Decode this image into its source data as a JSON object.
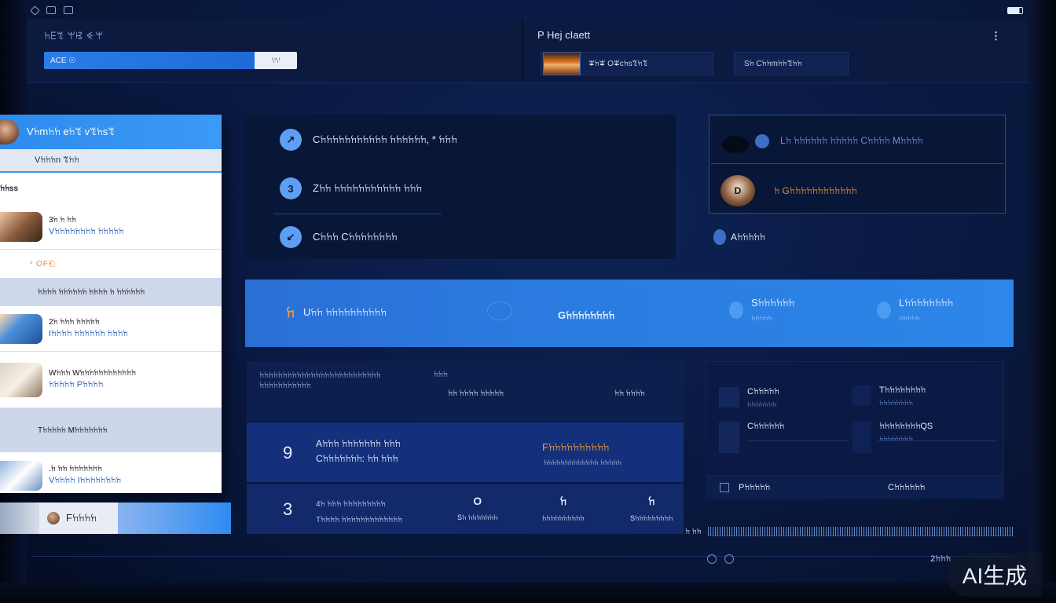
{
  "header": {
    "brand": "ꖷꗋꔳ ꕚꕙ ꔾꕚ",
    "search_value": "ACE ☉",
    "search_button": "ꗷꗷ",
    "doc_title": "P Hej cIaett",
    "more": "⋮",
    "file_chip_label": "ꕾꖷꕾ Oꕾcꖷsꔳꖷꔳ",
    "status_chip_label": "Sꖷ Cꖷꖷmꖷꖷꔳꖷꖷ"
  },
  "sidebar": {
    "title": "Vꖷmꖷꖷ eꖷꔳ vꔳꖷsꔳ",
    "view_label": "Vꖷꖷꖷn ꔳꖷꖷ",
    "section_label": "ꖷꖷss",
    "items": [
      {
        "title": "3ꖷ ꖷ ꖷꖷ",
        "subtitle": "Vꖷꖷꖷꖷꖷꖷꖷꖷ ꖷꖷꖷꖷꖷ"
      },
      {
        "title": "2ꖷ ꖷꖷꖷ ꖷꖷꖷꖷꖷ",
        "subtitle": "Iꖷꖷꖷꖷ ꖷꖷꖷꖷꖷꖷ ꖷꖷꖷꖷ"
      },
      {
        "title": "Wꖷꖷꖷ Wꖷꖷꖷꖷꖷꖷꖷꖷꖷꖷꖷꖷ",
        "subtitle": "ꖷꖷꖷꖷꖷ Pꖷꖷꖷꖷ"
      },
      {
        "title": ".ꖷ ꖷꖷ ꖷꖷꖷꖷꖷꖷꖷ",
        "subtitle": "Vꖷꖷꖷꖷ Iꖷꖷꖷꖷꖷꖷꖷꖷ"
      }
    ],
    "plain_row": "ᵛ OF⎗",
    "group_row_1": "ꖷꖷꖷꖷ ꖷꖷꖷꖷꖷꖷ ꖷꖷꖷꖷ ꖷ ꖷꖷꖷꖷꖷꖷ",
    "group_row_2": "Tꖷꖷꖷꖷꖷ Mꖷꖷꖷꖷꖷꖷꖷ",
    "footer_profile": "Fꖷꖷꖷꖷ"
  },
  "actions": [
    {
      "glyph": "↗",
      "label": "Cꖷꖷꖷꖷꖷꖷꖷꖷꖷꖷꖷ ꖷꖷꖷꖷꖷꖷ, * ꖷꖷꖷ"
    },
    {
      "glyph": "3",
      "label": "Zꖷꖷ ꖷꖷꖷꖷꖷꖷꖷꖷꖷꖷꖷ ꖷꖷꖷ"
    },
    {
      "glyph": "↙",
      "label": "Cꖷꖷꖷ Cꖷꖷꖷꖷꖷꖷꖷꖷ"
    }
  ],
  "notifications": {
    "row1": "Lꖷ ꖷꖷꖷꖷꖷꖷ ꖷꖷꖷꖷꖷ Cꖷꖷꖷꖷ Mꖷꖷꖷꖷ",
    "row2_badge": "D",
    "row2": "ꖷ Gꖷꖷꖷꖷꖷꖷꖷꖷꖷꖷꖷꖷ",
    "tag": "Aꖷꖷꖷꖷꖷ"
  },
  "toolbar": {
    "left_icon": "ꖷ",
    "left_label": "Uꖷꖷ ꖷꖷꖷꖷꖷꖷꖷꖷꖷꖷ",
    "center_label": "Gꖷꖷꖷꖷꖷꖷꖷꖷ",
    "right1_label": "Sꖷꖷꖷꖷꖷꖷ",
    "right1_sub": "ꖷꖷꖷꖷꖷ",
    "right2_label": "Lꖷꖷꖷꖷꖷꖷꖷꖷ",
    "right2_sub": "ꖷꖷꖷꖷꖷ"
  },
  "table": {
    "header_text": "ꖷꖷꖷꖷꖷꖷꖷꖷꖷꖷꖷꖷꖷꖷꖷꖷꖷꖷꖷꖷꖷꖷꖷꖷꖷꖷ ꖷꖷꖷꖷꖷꖷꖷꖷꖷꖷꖷ",
    "header_mid": "ꖷꖷꖷ",
    "header_val1": "ꖷꖷ ꖷꖷꖷꖷ ꖷꖷꖷꖷꖷ",
    "header_val2": "ꖷꖷ ꖷꖷꖷꖷ",
    "row2": {
      "number": "9",
      "line1": "Aꖷꖷꖷ ꖷꖷꖷꖷꖷꖷꖷ ꖷꖷꖷ",
      "line2": "Cꖷꖷꖷꖷꖷꖷꖷ: ꖷꖷ ꖷꖷꖷ",
      "accent": "Fꖷꖷꖷꖷꖷꖷꖷꖷꖷꖷ",
      "accent_sub": "ꖷꖷꖷꖷꖷꖷꖷꖷꖷꖷꖷꖷꖷ ꖷꖷꖷꖷꖷ"
    },
    "row3": {
      "number": "3",
      "line1": "4ꖷ ꖷꖷꖷ ꖷꖷꖷꖷꖷꖷꖷꖷꖷ",
      "line2": "Tꖷꖷꖷꖷ ꖷꖷꖷꖷꖷꖷꖷꖷꖷꖷꖷꖷꖷ",
      "cols": [
        {
          "glyph": "O",
          "label": "Sꖷ ꖷꖷꖷꖷꖷꖷꖷ"
        },
        {
          "glyph": "ꖷ",
          "label": "ꖷꖷꖷꖷꖷꖷꖷꖷꖷꖷ"
        },
        {
          "glyph": "ꖷ",
          "label": "Sꖷꖷꖷꖷꖷꖷꖷꖷꖷ"
        }
      ]
    }
  },
  "stats": {
    "s1": "Cꖷꖷꖷꖷꖷ",
    "s1_sub": "ꖷꖷꖷꖷꖷꖷꖷ",
    "s2": "Tꖷꖷꖷꖷꖷꖷꖷꖷ",
    "s2_sub": "ꖷꖷꖷꖷꖷꖷꖷꖷ",
    "s3": "Cꖷꖷꖷꖷꖷꖷ",
    "s4": "ꖷꖷꖷꖷꖷꖷꖷꖷQS",
    "s4_sub": "ꖷꖷꖷꖷꖷꖷꖷꖷ",
    "foot_left": "Pꖷꖷꖷꖷꖷ",
    "foot_right": "Cꖷꖷꖷꖷꖷꖷ"
  },
  "timeline": {
    "start": "ꖷ ꖷꖷ",
    "counter": "2ꖷꖷꖷ"
  },
  "watermark": "AI生成",
  "colors": {
    "accent_blue": "#2d86e8",
    "accent_orange": "#f39a3a",
    "panel_dark": "#081638"
  }
}
